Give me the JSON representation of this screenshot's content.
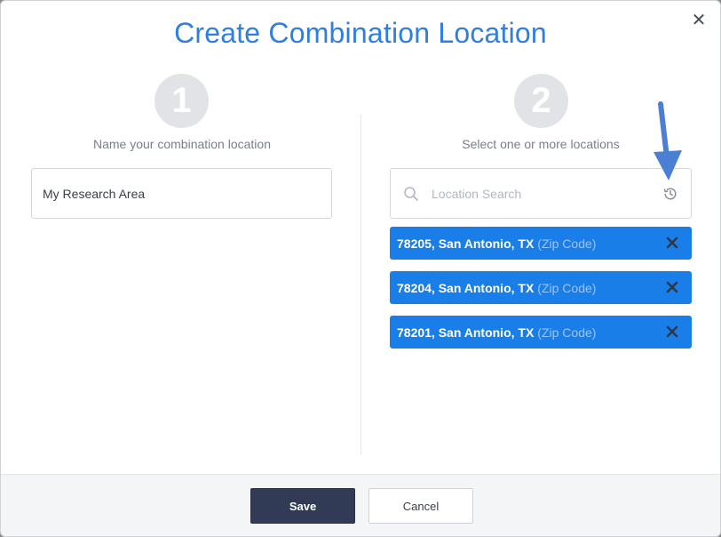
{
  "dialog": {
    "title": "Create Combination Location",
    "close_symbol": "✕"
  },
  "step1": {
    "number": "1",
    "label": "Name your combination location",
    "name_value": "My Research Area"
  },
  "step2": {
    "number": "2",
    "label": "Select one or more locations",
    "search_placeholder": "Location Search",
    "selected_locations": [
      {
        "name": "78205, San Antonio, TX",
        "type": "(Zip Code)"
      },
      {
        "name": "78204, San Antonio, TX",
        "type": "(Zip Code)"
      },
      {
        "name": "78201, San Antonio, TX",
        "type": "(Zip Code)"
      }
    ]
  },
  "footer": {
    "save_label": "Save",
    "cancel_label": "Cancel"
  },
  "icons": {
    "close": "close-icon",
    "search": "search-icon",
    "history": "history-icon",
    "remove": "remove-icon",
    "annotation_arrow": "arrow-down-icon"
  },
  "colors": {
    "accent": "#2f7fe0",
    "chip_bg": "#1a7ee8",
    "save_bg": "#323b55",
    "arrow": "#4a7fd4"
  }
}
